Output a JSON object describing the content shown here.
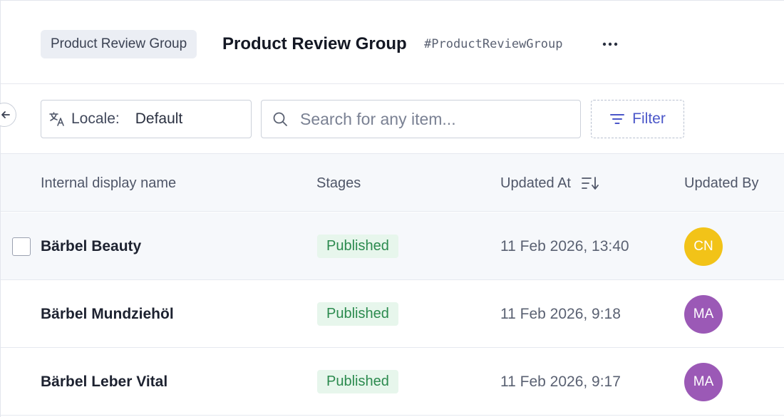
{
  "header": {
    "model_chip": "Product Review Group",
    "title": "Product Review Group",
    "api_id": "#ProductReviewGroup"
  },
  "toolbar": {
    "locale_label": "Locale:",
    "locale_value": "Default",
    "search_placeholder": "Search for any item...",
    "filter_label": "Filter"
  },
  "table": {
    "columns": {
      "name": "Internal display name",
      "stages": "Stages",
      "updated_at": "Updated At",
      "updated_by": "Updated By"
    },
    "rows": [
      {
        "name": "Bärbel Beauty",
        "stage": "Published",
        "updated_at": "11 Feb 2026, 13:40",
        "updated_by": "CN",
        "avatar_color": "#f2c318"
      },
      {
        "name": "Bärbel Mundziehöl",
        "stage": "Published",
        "updated_at": "11 Feb 2026, 9:18",
        "updated_by": "MA",
        "avatar_color": "#9b59b6"
      },
      {
        "name": "Bärbel Leber Vital",
        "stage": "Published",
        "updated_at": "11 Feb 2026, 9:17",
        "updated_by": "MA",
        "avatar_color": "#9b59b6"
      }
    ]
  },
  "colors": {
    "accent": "#4b57c9",
    "published_bg": "#e7f6ec",
    "published_text": "#2b8a4e"
  },
  "icons": {
    "more": "more-horizontal-icon",
    "collapse": "arrow-left-icon",
    "locale": "translate-icon",
    "search": "search-icon",
    "filter": "filter-icon",
    "sort": "sort-descending-icon"
  }
}
